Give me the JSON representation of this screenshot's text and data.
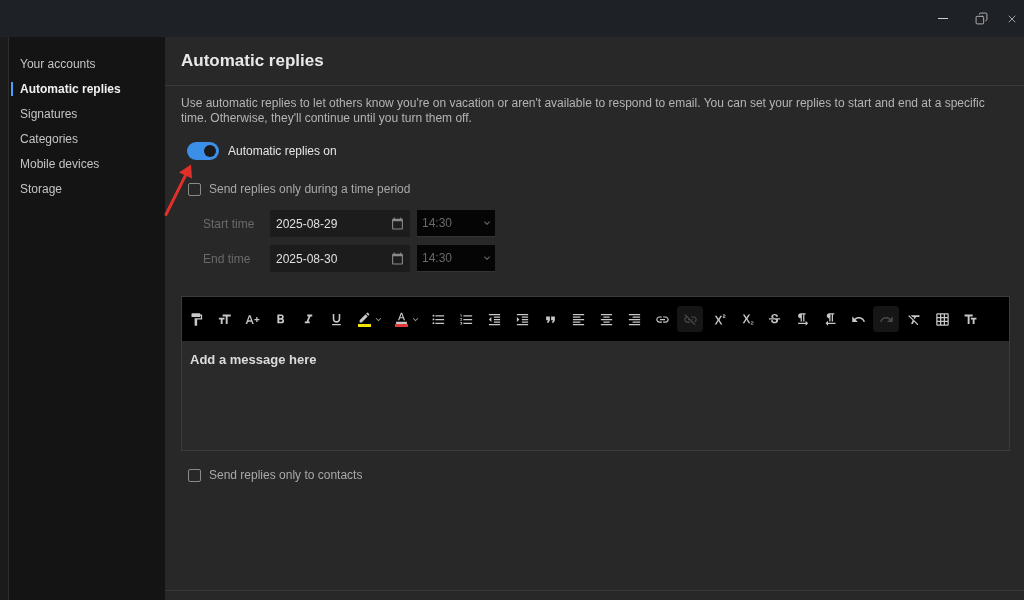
{
  "sidebar": {
    "items": [
      {
        "label": "Your accounts",
        "selected": false
      },
      {
        "label": "Automatic replies",
        "selected": true
      },
      {
        "label": "Signatures",
        "selected": false
      },
      {
        "label": "Categories",
        "selected": false
      },
      {
        "label": "Mobile devices",
        "selected": false
      },
      {
        "label": "Storage",
        "selected": false
      }
    ]
  },
  "page": {
    "title": "Automatic replies",
    "description": "Use automatic replies to let others know you're on vacation or aren't available to respond to email. You can set your replies to start and end at a specific time. Otherwise, they'll continue until you turn them off.",
    "toggle": {
      "label": "Automatic replies on",
      "on": true
    },
    "time_period": {
      "label": "Send replies only during a time period",
      "checked": false,
      "rows": [
        {
          "label": "Start time",
          "date": "2025-08-29",
          "time": "14:30",
          "disabled": true
        },
        {
          "label": "End time",
          "date": "2025-08-30",
          "time": "14:30",
          "disabled": true
        }
      ]
    },
    "editor": {
      "toolbar": [
        {
          "kind": "painter",
          "disabled": false
        },
        {
          "kind": "font_size",
          "disabled": false
        },
        {
          "kind": "grow_font",
          "disabled": false
        },
        {
          "kind": "bold",
          "disabled": false
        },
        {
          "kind": "italic",
          "disabled": false
        },
        {
          "kind": "underline",
          "disabled": false
        },
        {
          "kind": "highlight",
          "disabled": false
        },
        {
          "kind": "font_color",
          "disabled": false
        },
        {
          "kind": "bullets",
          "disabled": false
        },
        {
          "kind": "numbering",
          "disabled": false
        },
        {
          "kind": "outdent",
          "disabled": false
        },
        {
          "kind": "indent",
          "disabled": false
        },
        {
          "kind": "quote",
          "disabled": false
        },
        {
          "kind": "align_left",
          "disabled": false
        },
        {
          "kind": "align_center",
          "disabled": false
        },
        {
          "kind": "align_right",
          "disabled": false
        },
        {
          "kind": "link",
          "disabled": false
        },
        {
          "kind": "unlink",
          "disabled": true
        },
        {
          "kind": "superscript",
          "disabled": false
        },
        {
          "kind": "subscript",
          "disabled": false
        },
        {
          "kind": "strikethrough",
          "disabled": false
        },
        {
          "kind": "ltr",
          "disabled": false
        },
        {
          "kind": "rtl",
          "disabled": false
        },
        {
          "kind": "undo",
          "disabled": false
        },
        {
          "kind": "redo",
          "disabled": true
        },
        {
          "kind": "clear_format",
          "disabled": false
        },
        {
          "kind": "table",
          "disabled": false
        },
        {
          "kind": "text_styles",
          "disabled": false
        }
      ],
      "placeholder": "Add a message here"
    },
    "contacts_only": {
      "label": "Send replies only to contacts",
      "checked": false
    }
  }
}
